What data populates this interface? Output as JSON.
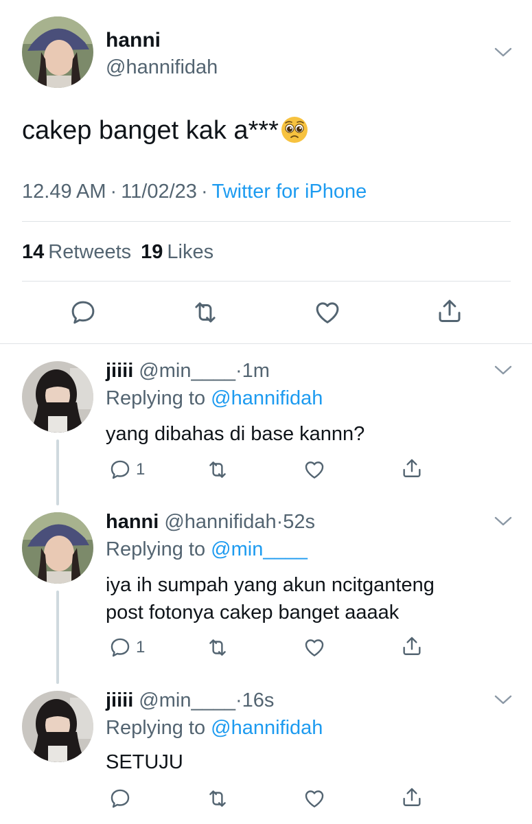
{
  "main_tweet": {
    "display_name": "hanni",
    "handle": "@hannifidah",
    "text": "cakep banget kak a***",
    "emoji": "pleading-face-emoji",
    "time": "12.49 AM",
    "date": "11/02/23",
    "separator": "·",
    "source": "Twitter for iPhone",
    "retweets_count": "14",
    "retweets_label": "Retweets",
    "likes_count": "19",
    "likes_label": "Likes",
    "actions": [
      "reply-icon",
      "retweet-icon",
      "like-icon",
      "share-icon"
    ]
  },
  "replies": [
    {
      "display_name": "jiiii",
      "handle": "@min____",
      "time": "·1m",
      "replying_label": "Replying to",
      "replying_to": "@hannifidah",
      "lines": [
        "yang dibahas di base kannn?"
      ],
      "reply_count": "1"
    },
    {
      "display_name": "hanni",
      "handle": "@hannifidah",
      "time": "·52s",
      "replying_label": "Replying to",
      "replying_to": "@min____",
      "lines": [
        "iya ih sumpah yang akun ncitganteng",
        "post fotonya cakep banget aaaak"
      ],
      "reply_count": "1"
    },
    {
      "display_name": "jiiii",
      "handle": "@min____",
      "time": "·16s",
      "replying_label": "Replying to",
      "replying_to": "@hannifidah",
      "lines": [
        "SETUJU"
      ],
      "reply_count": ""
    }
  ],
  "colors": {
    "text": "#0f1419",
    "secondary": "#536471",
    "link": "#1d9bf0",
    "divider": "#dfe3e6",
    "thread_line": "#cfd9de"
  }
}
